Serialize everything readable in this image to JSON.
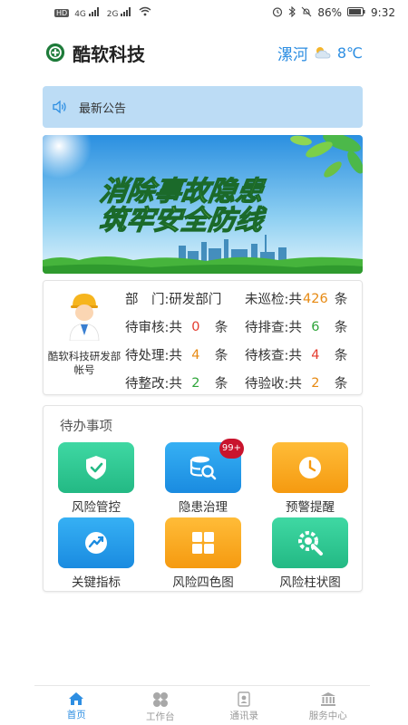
{
  "status_bar": {
    "left_indicators": [
      "HD",
      "4G",
      "2G"
    ],
    "battery": "86%",
    "time": "9:32"
  },
  "header": {
    "app_name": "酷软科技",
    "city": "漯河",
    "temperature": "8℃",
    "weather_icon": "cloudy-sun-icon"
  },
  "notice": {
    "icon": "speaker-icon",
    "text": "最新公告"
  },
  "banner": {
    "line1": "消除事故隐患",
    "line2": "筑牢安全防线"
  },
  "user": {
    "department_account": "酷软科技研发部帐号",
    "dept_label": "部　门:",
    "dept_value": "研发部门",
    "stats": [
      [
        {
          "label": "待审核:",
          "prefix": "共",
          "value": "0",
          "suffix": "条",
          "color": "#e43b2e"
        },
        {
          "label": "待排查:",
          "prefix": "共",
          "value": "6",
          "suffix": "条",
          "color": "#2fa53a"
        }
      ],
      [
        {
          "label": "待处理:",
          "prefix": "共",
          "value": "4",
          "suffix": "条",
          "color": "#e78a13"
        },
        {
          "label": "待核查:",
          "prefix": "共",
          "value": "4",
          "suffix": "条",
          "color": "#e43b2e"
        }
      ],
      [
        {
          "label": "待整改:",
          "prefix": "共",
          "value": "2",
          "suffix": "条",
          "color": "#2fa53a"
        },
        {
          "label": "待验收:",
          "prefix": "共",
          "value": "2",
          "suffix": "条",
          "color": "#e78a13"
        }
      ]
    ],
    "patrol": {
      "label": "未巡检:",
      "prefix": "共",
      "value": "426",
      "suffix": "条",
      "color": "#e78a13"
    }
  },
  "todo": {
    "title": "待办事项",
    "tiles": [
      {
        "label": "风险管控",
        "icon": "shield-check-icon",
        "color": "#23b984"
      },
      {
        "label": "隐患治理",
        "icon": "database-search-icon",
        "color": "#1a8be0",
        "badge": "99+"
      },
      {
        "label": "预警提醒",
        "icon": "clock-icon",
        "color": "#f59a10"
      },
      {
        "label": "关键指标",
        "icon": "trend-chart-icon",
        "color": "#1a8be0"
      },
      {
        "label": "风险四色图",
        "icon": "grid-four-icon",
        "color": "#f59a10"
      },
      {
        "label": "风险柱状图",
        "icon": "gear-wrench-icon",
        "color": "#23b984"
      }
    ]
  },
  "bottom_nav": [
    {
      "label": "首页",
      "icon": "home-icon",
      "active": true
    },
    {
      "label": "工作台",
      "icon": "four-leaf-icon",
      "active": false
    },
    {
      "label": "通讯录",
      "icon": "contacts-icon",
      "active": false
    },
    {
      "label": "服务中心",
      "icon": "bank-icon",
      "active": false
    }
  ],
  "colors": {
    "accent": "#2d8ee2",
    "notice_bg": "#bcdcf5",
    "badge": "#c9142d"
  }
}
